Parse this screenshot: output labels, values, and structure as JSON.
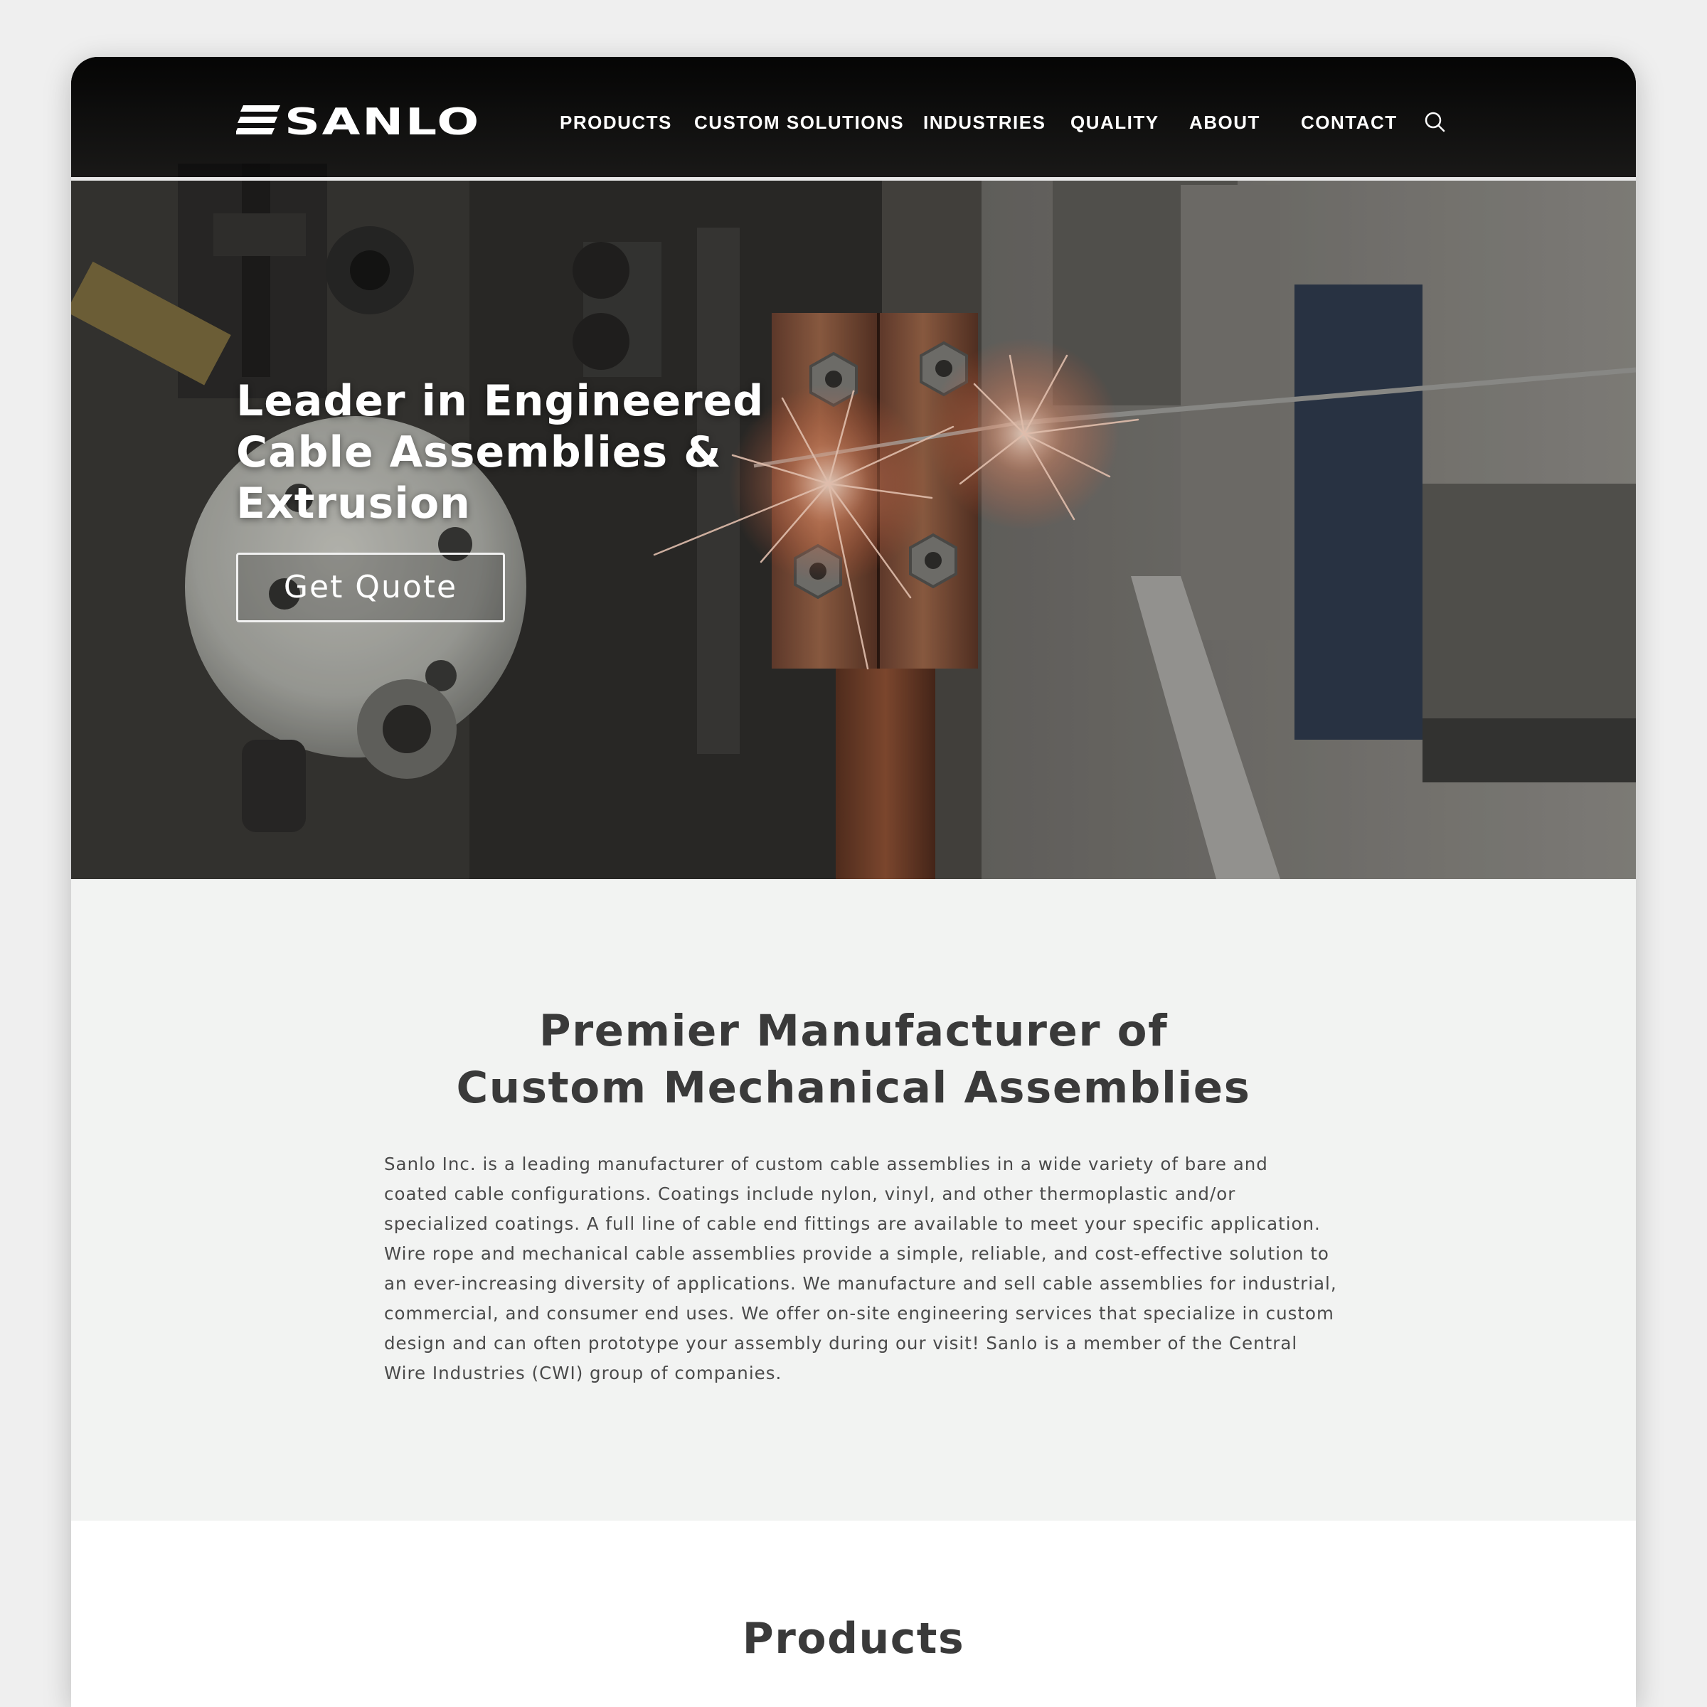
{
  "brand": {
    "logo_text": "SANLO"
  },
  "nav": {
    "items": [
      {
        "label": "PRODUCTS"
      },
      {
        "label": "CUSTOM SOLUTIONS"
      },
      {
        "label": "INDUSTRIES"
      },
      {
        "label": "QUALITY"
      },
      {
        "label": "ABOUT"
      },
      {
        "label": "CONTACT"
      }
    ],
    "search_icon": "search-icon"
  },
  "hero": {
    "title": "Leader in Engineered Cable Assemblies & Extrusion",
    "cta_label": "Get Quote"
  },
  "intro": {
    "title_line1": "Premier Manufacturer of",
    "title_line2": "Custom Mechanical Assemblies",
    "body": "Sanlo Inc. is a leading manufacturer of custom cable assemblies in a wide variety of bare and coated cable configurations. Coatings include nylon, vinyl, and other thermoplastic and/or specialized coatings. A full line of cable end fittings are available to meet your specific application. Wire rope and mechanical cable assemblies provide a simple, reliable, and cost-effective solution to an ever-increasing diversity of applications. We manufacture and sell cable assemblies for industrial, commercial, and consumer end uses. We offer on-site engineering services that specialize in custom design and can often prototype your assembly during our visit! Sanlo is a member of the Central Wire Industries (CWI) group of companies."
  },
  "products": {
    "title": "Products"
  },
  "colors": {
    "page_background": "#efefef",
    "header_background": "#0a0a0a",
    "intro_background": "#f2f3f2",
    "heading_text": "#3a3a3a",
    "body_text": "#4a4a4a",
    "hero_text": "#ffffff"
  }
}
